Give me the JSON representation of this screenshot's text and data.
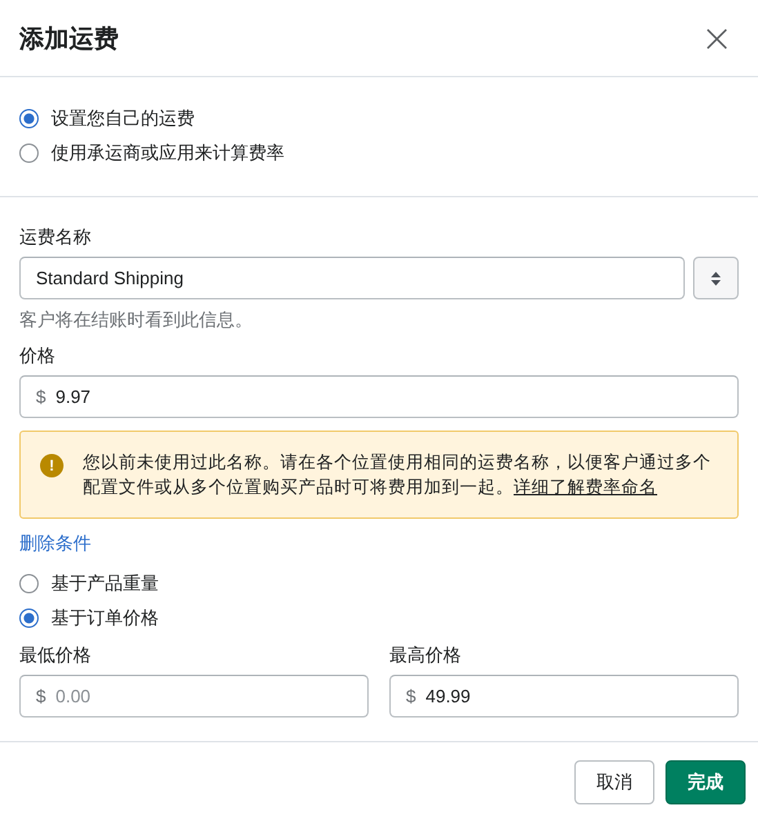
{
  "window": {
    "title": "添加运费",
    "close": "×"
  },
  "rate_type": [
    {
      "label": "设置您自己的运费",
      "selected": true
    },
    {
      "label": "使用承运商或应用来计算费率",
      "selected": false
    }
  ],
  "name_field": {
    "label": "运费名称",
    "value": "Standard Shipping",
    "hint": "客户将在结账时看到此信息。"
  },
  "price_field": {
    "label": "价格",
    "prefix": "$",
    "value": "9.97"
  },
  "warning": {
    "icon": "!",
    "text": "您以前未使用过此名称。请在各个位置使用相同的运费名称，以便客户通过多个配置文件或从多个位置购买产品时可将费用加到一起。",
    "link": "详细了解费率命名"
  },
  "remove_conditions_link": "删除条件",
  "condition_type": [
    {
      "label": "基于产品重量",
      "selected": false
    },
    {
      "label": "基于订单价格",
      "selected": true
    }
  ],
  "range_fields": [
    {
      "label": "最低价格",
      "prefix": "$",
      "placeholder": "0.00"
    },
    {
      "label": "最高价格",
      "prefix": "$",
      "value": "49.99"
    }
  ],
  "buttons": [
    {
      "label": "取消",
      "kind": "secondary"
    },
    {
      "label": "完成",
      "kind": "primary"
    }
  ]
}
